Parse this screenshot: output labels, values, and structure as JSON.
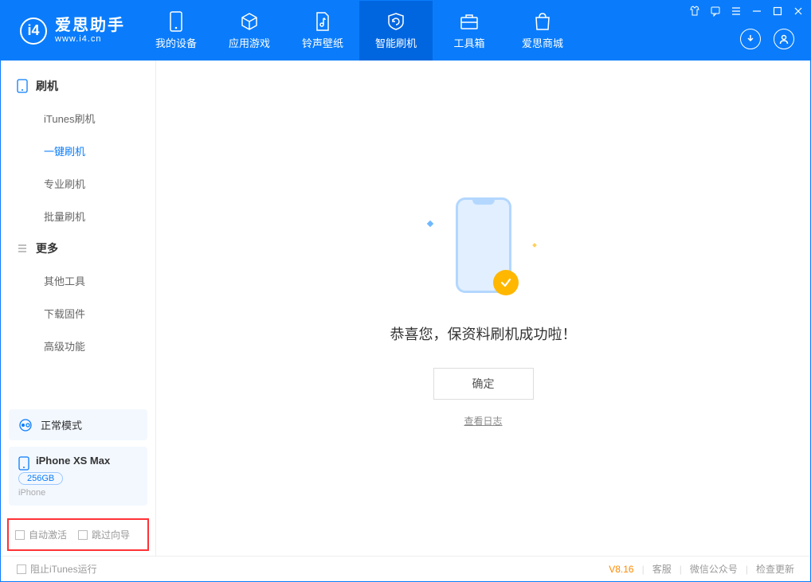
{
  "app": {
    "title": "爱思助手",
    "subtitle": "www.i4.cn"
  },
  "tabs": [
    {
      "label": "我的设备"
    },
    {
      "label": "应用游戏"
    },
    {
      "label": "铃声壁纸"
    },
    {
      "label": "智能刷机"
    },
    {
      "label": "工具箱"
    },
    {
      "label": "爱思商城"
    }
  ],
  "sidebar": {
    "group1": {
      "title": "刷机",
      "items": [
        {
          "label": "iTunes刷机"
        },
        {
          "label": "一键刷机"
        },
        {
          "label": "专业刷机"
        },
        {
          "label": "批量刷机"
        }
      ]
    },
    "group2": {
      "title": "更多",
      "items": [
        {
          "label": "其他工具"
        },
        {
          "label": "下载固件"
        },
        {
          "label": "高级功能"
        }
      ]
    },
    "mode": "正常模式",
    "device": {
      "name": "iPhone XS Max",
      "capacity": "256GB",
      "type": "iPhone"
    },
    "options": {
      "auto_activate": "自动激活",
      "skip_guide": "跳过向导"
    }
  },
  "main": {
    "success_msg": "恭喜您，保资料刷机成功啦！",
    "ok_btn": "确定",
    "log_link": "查看日志"
  },
  "footer": {
    "block_itunes": "阻止iTunes运行",
    "version": "V8.16",
    "links": {
      "service": "客服",
      "wechat": "微信公众号",
      "update": "检查更新"
    }
  }
}
